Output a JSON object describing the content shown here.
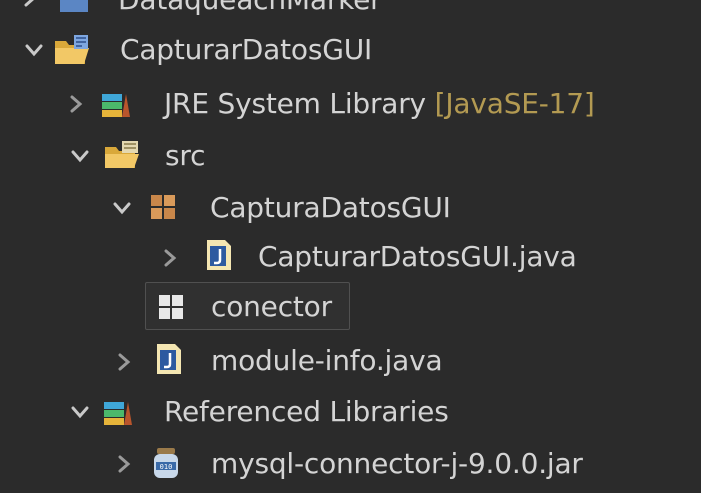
{
  "tree": {
    "items": [
      {
        "label": "DataqueachMarker",
        "expanded": false
      },
      {
        "label": "CapturarDatosGUI",
        "expanded": true,
        "icon": "project-folder-icon"
      },
      {
        "label": "JRE System Library",
        "decorator": "[JavaSE-17]",
        "expanded": false,
        "icon": "library-icon"
      },
      {
        "label": "src",
        "expanded": true,
        "icon": "source-folder-icon"
      },
      {
        "label": "CapturaDatosGUI",
        "expanded": true,
        "icon": "package-icon"
      },
      {
        "label": "CapturarDatosGUI.java",
        "expanded": false,
        "icon": "java-file-icon"
      },
      {
        "label": "conector",
        "selected": true,
        "icon": "empty-package-icon"
      },
      {
        "label": "module-info.java",
        "expanded": false,
        "icon": "java-file-icon"
      },
      {
        "label": "Referenced Libraries",
        "expanded": true,
        "icon": "library-icon"
      },
      {
        "label": "mysql-connector-j-9.0.0.jar",
        "expanded": false,
        "icon": "jar-icon"
      }
    ]
  },
  "colors": {
    "background": "#2b2b2b",
    "text": "#d4d4d4",
    "decorator": "#b39a52",
    "chevron": "#c9c9c9",
    "selection_border": "#505050"
  }
}
